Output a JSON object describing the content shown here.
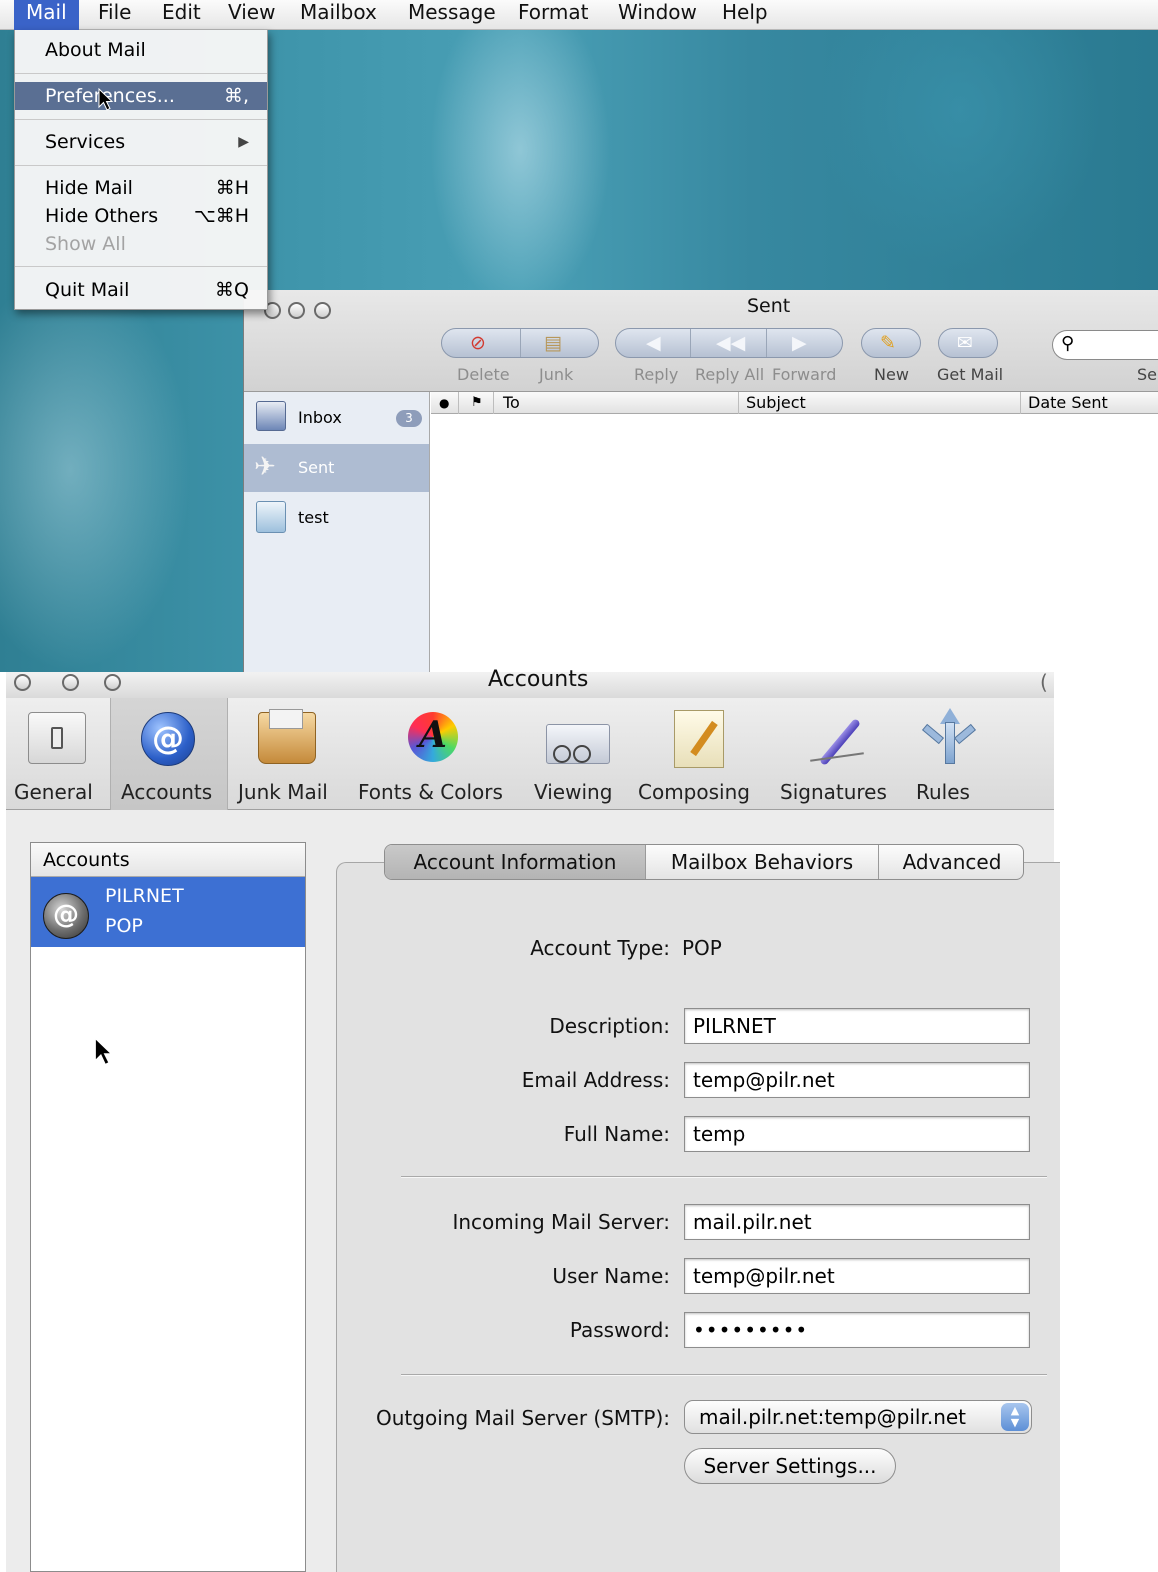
{
  "menubar": {
    "items": [
      "Mail",
      "File",
      "Edit",
      "View",
      "Mailbox",
      "Message",
      "Format",
      "Window",
      "Help"
    ]
  },
  "app_menu": {
    "items": [
      {
        "label": "About Mail",
        "shortcut": ""
      },
      {
        "label": "Preferences...",
        "shortcut": "⌘,"
      },
      {
        "label": "Services",
        "shortcut": "▶"
      },
      {
        "label": "Hide Mail",
        "shortcut": "⌘H"
      },
      {
        "label": "Hide Others",
        "shortcut": "⌥⌘H"
      },
      {
        "label": "Show All",
        "shortcut": ""
      },
      {
        "label": "Quit Mail",
        "shortcut": "⌘Q"
      }
    ]
  },
  "sent_window": {
    "title": "Sent",
    "toolbar": {
      "delete": "Delete",
      "junk": "Junk",
      "reply": "Reply",
      "reply_all": "Reply All",
      "forward": "Forward",
      "new": "New",
      "get_mail": "Get Mail",
      "search_partial": "Se"
    },
    "mailboxes": [
      {
        "label": "Inbox",
        "badge": "3"
      },
      {
        "label": "Sent",
        "badge": ""
      },
      {
        "label": "test",
        "badge": ""
      }
    ],
    "columns": {
      "status": "●",
      "flag": "⚑",
      "to": "To",
      "subject": "Subject",
      "date_sent": "Date Sent"
    }
  },
  "accounts_window": {
    "title": "Accounts",
    "toolbar": [
      {
        "label": "General",
        "icon": "switch-icon"
      },
      {
        "label": "Accounts",
        "icon": "at-sign-icon"
      },
      {
        "label": "Junk Mail",
        "icon": "junk-mail-icon"
      },
      {
        "label": "Fonts & Colors",
        "icon": "fonts-colors-icon"
      },
      {
        "label": "Viewing",
        "icon": "viewing-icon"
      },
      {
        "label": "Composing",
        "icon": "composing-icon"
      },
      {
        "label": "Signatures",
        "icon": "signature-pen-icon"
      },
      {
        "label": "Rules",
        "icon": "rules-icon"
      }
    ],
    "accounts_list": {
      "header": "Accounts",
      "items": [
        {
          "name": "PILRNET",
          "type": "POP"
        }
      ]
    },
    "tabs": [
      "Account Information",
      "Mailbox Behaviors",
      "Advanced"
    ],
    "form": {
      "account_type_label": "Account Type:",
      "account_type_value": "POP",
      "description_label": "Description:",
      "description_value": "PILRNET",
      "email_label": "Email Address:",
      "email_value": "temp@pilr.net",
      "full_name_label": "Full Name:",
      "full_name_value": "temp",
      "incoming_label": "Incoming Mail Server:",
      "incoming_value": "mail.pilr.net",
      "user_name_label": "User Name:",
      "user_name_value": "temp@pilr.net",
      "password_label": "Password:",
      "password_value": "•••••••••",
      "smtp_label": "Outgoing Mail Server (SMTP):",
      "smtp_value": "mail.pilr.net:temp@pilr.net",
      "server_settings_label": "Server Settings..."
    }
  },
  "colors": {
    "menu_highlight": "#5a6f93",
    "selection_blue": "#3d70d3",
    "desktop_teal": "#3f95ab"
  }
}
